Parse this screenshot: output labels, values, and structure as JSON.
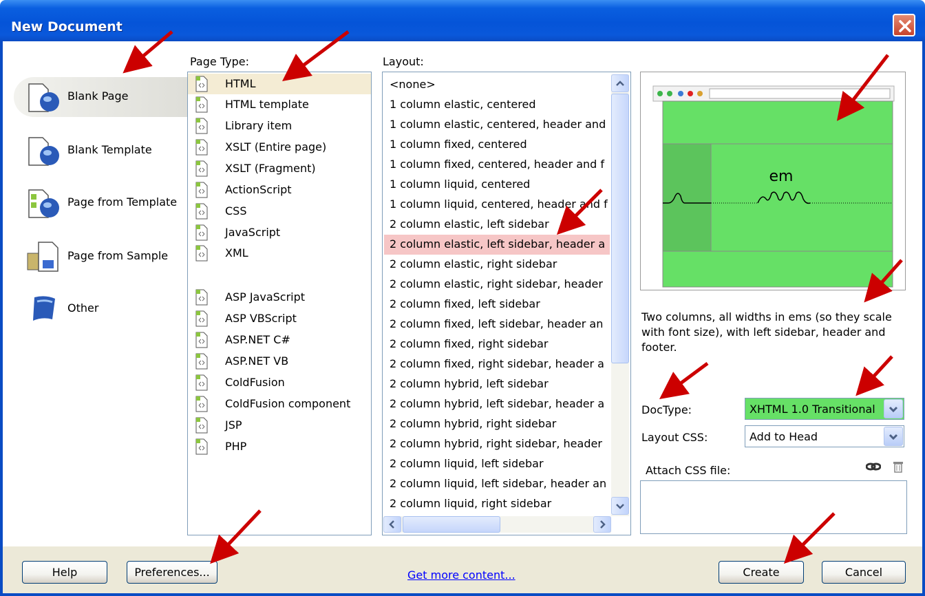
{
  "window": {
    "title": "New Document"
  },
  "categories": [
    {
      "label": "Blank Page",
      "icon": "blank-page-icon",
      "selected": true
    },
    {
      "label": "Blank Template",
      "icon": "blank-template-icon"
    },
    {
      "label": "Page from Template",
      "icon": "page-from-template-icon"
    },
    {
      "label": "Page from Sample",
      "icon": "page-from-sample-icon"
    },
    {
      "label": "Other",
      "icon": "other-icon"
    }
  ],
  "page_type": {
    "label": "Page Type:",
    "items": [
      "HTML",
      "HTML template",
      "Library item",
      "XSLT (Entire page)",
      "XSLT (Fragment)",
      "ActionScript",
      "CSS",
      "JavaScript",
      "XML",
      "ASP JavaScript",
      "ASP VBScript",
      "ASP.NET C#",
      "ASP.NET VB",
      "ColdFusion",
      "ColdFusion component",
      "JSP",
      "PHP"
    ],
    "selected": "HTML"
  },
  "layout": {
    "label": "Layout:",
    "items": [
      "<none>",
      "1 column elastic, centered",
      "1 column elastic, centered, header and",
      "1 column fixed, centered",
      "1 column fixed, centered, header and f",
      "1 column liquid, centered",
      "1 column liquid, centered, header and f",
      "2 column elastic, left sidebar",
      "2 column elastic, left sidebar, header a",
      "2 column elastic, right sidebar",
      "2 column elastic, right sidebar, header",
      "2 column fixed, left sidebar",
      "2 column fixed, left sidebar, header an",
      "2 column fixed, right sidebar",
      "2 column fixed, right sidebar, header a",
      "2 column hybrid, left sidebar",
      "2 column hybrid, left sidebar, header a",
      "2 column hybrid, right sidebar",
      "2 column hybrid, right sidebar, header",
      "2 column liquid, left sidebar",
      "2 column liquid, left sidebar, header an",
      "2 column liquid, right sidebar"
    ],
    "selected": "2 column elastic, left sidebar, header a"
  },
  "preview": {
    "unit_label": "em"
  },
  "description": "Two columns, all widths in ems (so they scale with font size), with left sidebar, header and footer.",
  "doctype": {
    "label": "DocType:",
    "value": "XHTML 1.0 Transitional"
  },
  "layout_css": {
    "label": "Layout CSS:",
    "value": "Add to Head"
  },
  "attach_css": {
    "label": "Attach CSS file:"
  },
  "buttons": {
    "help": "Help",
    "preferences": "Preferences...",
    "create": "Create",
    "cancel": "Cancel"
  },
  "links": {
    "more_content": "Get more content..."
  },
  "colors": {
    "titlebar": "#0554d8",
    "selection_highlight": "#f6c6c6",
    "preview_green": "#66e066",
    "doctype_bg": "#66e066",
    "annotation_arrow": "#cc0000"
  }
}
